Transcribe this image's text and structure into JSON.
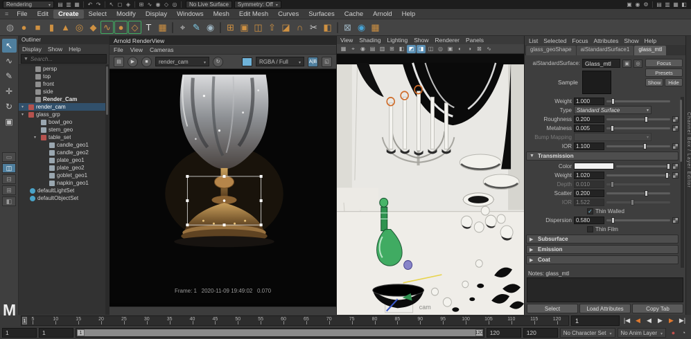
{
  "branding": {
    "logo_letter": "M"
  },
  "status_line": {
    "menuset": "Rendering",
    "live_surface": "No Live Surface",
    "symmetry": "Symmetry: Off",
    "left_icons": [
      {
        "name": "new-scene-icon",
        "glyph": "▤"
      },
      {
        "name": "open-scene-icon",
        "glyph": "▥"
      },
      {
        "name": "save-scene-icon",
        "glyph": "▦"
      },
      {
        "sep": true,
        "glyph": ""
      },
      {
        "name": "undo-icon",
        "glyph": "↶"
      },
      {
        "name": "redo-icon",
        "glyph": "↷"
      },
      {
        "sep": true,
        "glyph": ""
      },
      {
        "name": "select-by-hierarchy-icon",
        "glyph": "↖"
      },
      {
        "name": "select-by-object-icon",
        "glyph": "◻"
      },
      {
        "name": "select-by-component-icon",
        "glyph": "◈"
      },
      {
        "sep": true,
        "glyph": ""
      },
      {
        "name": "snap-to-grid-icon",
        "glyph": "⊞"
      },
      {
        "name": "snap-to-curve-icon",
        "glyph": "∿"
      },
      {
        "name": "snap-to-point-icon",
        "glyph": "◉"
      },
      {
        "name": "snap-to-plane-icon",
        "glyph": "◇"
      },
      {
        "name": "make-live-icon",
        "glyph": "◎"
      },
      {
        "sep": true,
        "glyph": ""
      }
    ],
    "right_icons": [
      {
        "name": "render-current-frame-icon",
        "glyph": "▣"
      },
      {
        "name": "ipr-render-icon",
        "glyph": "◉"
      },
      {
        "name": "render-settings-icon",
        "glyph": "⚙"
      },
      {
        "sep": true,
        "glyph": ""
      },
      {
        "name": "outliner-toggle-icon",
        "glyph": "▤"
      },
      {
        "name": "channel-box-toggle-icon",
        "glyph": "▥"
      },
      {
        "name": "attribute-editor-toggle-icon",
        "glyph": "▦",
        "active": true
      },
      {
        "name": "tool-settings-toggle-icon",
        "glyph": "◧"
      }
    ]
  },
  "menu_bar": {
    "grip": "≡",
    "items": [
      {
        "label": "File"
      },
      {
        "label": "Edit"
      },
      {
        "label": "Create",
        "active": true
      },
      {
        "label": "Select"
      },
      {
        "label": "Modify"
      },
      {
        "label": "Display"
      },
      {
        "label": "Windows"
      },
      {
        "label": "Mesh"
      },
      {
        "label": "Edit Mesh"
      },
      {
        "label": "Curves"
      },
      {
        "label": "Surfaces"
      },
      {
        "label": "Cache"
      },
      {
        "label": "Arnold"
      },
      {
        "label": "Help"
      }
    ]
  },
  "shelf": {
    "icons": [
      {
        "name": "shelf-tab-icon",
        "glyph": "◍",
        "color": "#9a9a9a"
      },
      {
        "name": "poly-sphere-icon",
        "glyph": "●",
        "color": "#cf9142"
      },
      {
        "name": "poly-cube-icon",
        "glyph": "■",
        "color": "#cf9142"
      },
      {
        "name": "poly-cylinder-icon",
        "glyph": "▮",
        "color": "#cf9142"
      },
      {
        "name": "poly-cone-icon",
        "glyph": "▲",
        "color": "#cf9142"
      },
      {
        "name": "poly-torus-icon",
        "glyph": "◎",
        "color": "#cf9142"
      },
      {
        "name": "poly-plane-icon",
        "glyph": "◆",
        "color": "#cf9142"
      },
      {
        "name": "curve-tool-icon",
        "glyph": "∿",
        "color": "#cf9142",
        "bracket": true
      },
      {
        "name": "circle-curve-icon",
        "glyph": "●",
        "color": "#cf9142",
        "bracket": true
      },
      {
        "name": "square-curve-icon",
        "glyph": "◇",
        "color": "#cf9142",
        "bracket": true
      },
      {
        "name": "type-tool-icon",
        "glyph": "T",
        "color": "#e6e6e6"
      },
      {
        "name": "construction-plane-icon",
        "glyph": "▦",
        "color": "#cf9142"
      },
      {
        "divider": true,
        "glyph": ""
      },
      {
        "name": "measure-tool-icon",
        "glyph": "⌖",
        "color": "#c9c9c9"
      },
      {
        "name": "paint-effects-icon",
        "glyph": "✎",
        "color": "#7ec8e3"
      },
      {
        "name": "sculpt-tool-icon",
        "glyph": "◉",
        "color": "#9fb6c3"
      },
      {
        "divider": true,
        "glyph": ""
      },
      {
        "name": "booleans-icon",
        "glyph": "⊞",
        "color": "#cf9142"
      },
      {
        "name": "combine-icon",
        "glyph": "▣",
        "color": "#cf9142"
      },
      {
        "name": "separate-icon",
        "glyph": "◫",
        "color": "#cf9142"
      },
      {
        "name": "extrude-icon",
        "glyph": "⇧",
        "color": "#cf9142"
      },
      {
        "name": "bevel-icon",
        "glyph": "◪",
        "color": "#cf9142"
      },
      {
        "name": "bridge-icon",
        "glyph": "∩",
        "color": "#cf9142"
      },
      {
        "name": "multi-cut-icon",
        "glyph": "✂",
        "color": "#d0d0d0"
      },
      {
        "name": "mirror-icon",
        "glyph": "◧",
        "color": "#cf9142"
      },
      {
        "divider": true,
        "glyph": ""
      },
      {
        "name": "uv-editor-icon",
        "glyph": "⊠",
        "color": "#9fb6c3"
      },
      {
        "name": "hypershade-icon",
        "glyph": "◉",
        "color": "#46a3d6"
      },
      {
        "name": "render-view-icon",
        "glyph": "▦",
        "color": "#cf9142"
      }
    ]
  },
  "toolbox": {
    "tools": [
      {
        "name": "select-tool",
        "glyph": "↖",
        "active": true
      },
      {
        "name": "lasso-tool",
        "glyph": "∿"
      },
      {
        "name": "paint-select-tool",
        "glyph": "✎"
      },
      {
        "name": "move-tool",
        "glyph": "✛"
      },
      {
        "name": "rotate-tool",
        "glyph": "↻"
      },
      {
        "name": "scale-tool",
        "glyph": "▣"
      }
    ],
    "layouts": [
      {
        "name": "layout-single-pane",
        "glyph": "▭"
      },
      {
        "name": "layout-two-pane",
        "glyph": "◫",
        "active": true
      },
      {
        "name": "layout-two-stacked",
        "glyph": "⊟"
      },
      {
        "name": "layout-four-pane",
        "glyph": "⊞"
      },
      {
        "name": "layout-outliner-persp",
        "glyph": "◧"
      }
    ]
  },
  "outliner": {
    "title": "Outliner",
    "menus": [
      "Display",
      "Show",
      "Help"
    ],
    "search_placeholder": "Search...",
    "filter_glyph": "▼",
    "items": [
      {
        "label": "persp",
        "icolor": "#8f8f8f",
        "pad": "14px"
      },
      {
        "label": "top",
        "icolor": "#8f8f8f",
        "pad": "14px"
      },
      {
        "label": "front",
        "icolor": "#8f8f8f",
        "pad": "14px"
      },
      {
        "label": "side",
        "icolor": "#8f8f8f",
        "pad": "14px"
      },
      {
        "label": "Render_Cam",
        "icolor": "#8f8f8f",
        "pad": "14px",
        "bold": true
      },
      {
        "label": "render_cam",
        "icolor": "#b5524e",
        "pad": "4px",
        "exp": true,
        "sel": true
      },
      {
        "label": "glass_grp",
        "icolor": "#b5524e",
        "pad": "4px",
        "exp": true
      },
      {
        "label": "bowl_geo",
        "icolor": "#9aa7b0",
        "pad": "22px"
      },
      {
        "label": "stem_geo",
        "icolor": "#9aa7b0",
        "pad": "22px"
      },
      {
        "label": "table_set",
        "icolor": "#b5524e",
        "pad": "22px",
        "exp": true
      },
      {
        "label": "candle_geo1",
        "icolor": "#9aa7b0",
        "pad": "34px"
      },
      {
        "label": "candle_geo2",
        "icolor": "#9aa7b0",
        "pad": "34px"
      },
      {
        "label": "plate_geo1",
        "icolor": "#9aa7b0",
        "pad": "34px"
      },
      {
        "label": "plate_geo2",
        "icolor": "#9aa7b0",
        "pad": "34px"
      },
      {
        "label": "goblet_geo1",
        "icolor": "#9aa7b0",
        "pad": "34px"
      },
      {
        "label": "napkin_geo1",
        "icolor": "#9aa7b0",
        "pad": "34px"
      },
      {
        "label": "defaultLightSet",
        "icolor": "#4aa3c8",
        "pad": "6px",
        "rnd": true
      },
      {
        "label": "defaultObjectSet",
        "icolor": "#4aa3c8",
        "pad": "6px",
        "rnd": true
      }
    ]
  },
  "render_view": {
    "title": "Arnold RenderView",
    "menus": [
      "File",
      "View",
      "Cameras"
    ],
    "toolbar": {
      "snapshot_glyph": "▤",
      "play_glyph": "▶",
      "stop_glyph": "■",
      "camera_value": "render_cam",
      "refresh_glyph": "↻",
      "display_value": "RGBA / Full",
      "ab_label": "A|B",
      "expand_glyph": "◱"
    },
    "frame_text": "Frame: 1   2020-11-09 19:49:02   0.070"
  },
  "viewport": {
    "menus": [
      "View",
      "Shading",
      "Lighting",
      "Show",
      "Renderer",
      "Panels"
    ],
    "camera_label": "cam",
    "icons": [
      {
        "name": "select-camera-icon",
        "glyph": "▦"
      },
      {
        "name": "lock-camera-icon",
        "glyph": "⌖"
      },
      {
        "name": "camera-attributes-icon",
        "glyph": "◉"
      },
      {
        "name": "bookmarks-icon",
        "glyph": "▤"
      },
      {
        "name": "image-plane-icon",
        "glyph": "▥"
      },
      {
        "name": "2d-pan-zoom-icon",
        "glyph": "⊞"
      },
      {
        "name": "oneclick-sync-icon",
        "glyph": "◧"
      },
      {
        "name": "isolate-select-icon",
        "glyph": "◩",
        "active": true
      },
      {
        "name": "xray-icon",
        "glyph": "◨",
        "active": true
      },
      {
        "name": "wireframe-on-shaded-icon",
        "glyph": "◫"
      },
      {
        "name": "default-material-icon",
        "glyph": "◎"
      },
      {
        "name": "textured-icon",
        "glyph": "▣"
      },
      {
        "name": "lighting-icon",
        "glyph": "◐"
      },
      {
        "name": "shadows-icon",
        "glyph": "◑"
      },
      {
        "name": "screen-space-ao-icon",
        "glyph": "⊠"
      },
      {
        "name": "motion-blur-icon",
        "glyph": "∿"
      }
    ]
  },
  "attribute_editor": {
    "menus": [
      "List",
      "Selected",
      "Focus",
      "Attributes",
      "Show",
      "Help"
    ],
    "tabs": [
      {
        "label": "glass_geoShape"
      },
      {
        "label": "aiStandardSurface1"
      },
      {
        "label": "glass_mtl",
        "active": true
      }
    ],
    "name_label": "aiStandardSurface:",
    "name_value": "Glass_mtl",
    "buttons": {
      "focus": "Focus",
      "presets": "Presets",
      "show": "Show",
      "hide": "Hide"
    },
    "sample_label": "Sample",
    "rows": [
      {
        "label": "Weight",
        "value": "1.000",
        "fill": "8%",
        "nock": true
      },
      {
        "label": "Type",
        "value": "Standard Surface",
        "dd": true
      },
      {
        "label": "Roughness",
        "value": "0.200",
        "fill": "60%"
      },
      {
        "label": "Metalness",
        "value": "0.005",
        "fill": "6%"
      },
      {
        "label": "Bump Mapping",
        "value": "",
        "dd": true,
        "dim": true
      },
      {
        "label": "IOR",
        "value": "1.100",
        "fill": "58%"
      },
      {
        "label": "Transmission",
        "sec": true,
        "open": true
      },
      {
        "label": "Color",
        "swatch": "#f2f2f2",
        "fill": "93%",
        "col": true
      },
      {
        "label": "Weight",
        "value": "1.020",
        "fill": "92%"
      },
      {
        "label": "Depth",
        "value": "0.010",
        "fill": "6%",
        "dim": true,
        "nock": true
      },
      {
        "label": "Scatter",
        "value": "0.200",
        "fill": "60%",
        "nock": true
      },
      {
        "label": "IOR",
        "value": "1.522",
        "fill": "38%",
        "dim": true,
        "nock": true
      },
      {
        "label": "Thin Walled",
        "chk": true,
        "on": true
      },
      {
        "label": "Dispersion",
        "value": "0.580",
        "fill": "8%"
      },
      {
        "label": "Thin Film",
        "chk": true
      },
      {
        "label": "Subsurface",
        "sec": true
      },
      {
        "label": "Emission",
        "sec": true
      },
      {
        "label": "Coat",
        "sec": true
      }
    ],
    "notes_label": "Notes: glass_mtl",
    "footer_buttons": [
      "Select",
      "Load Attributes",
      "Copy Tab"
    ]
  },
  "right_strip": {
    "label": "Channel Box / Layer Editor"
  },
  "timeline": {
    "cursor_label": "1",
    "ticks": [
      "5",
      "10",
      "15",
      "20",
      "25",
      "30",
      "35",
      "40",
      "45",
      "50",
      "55",
      "60",
      "65",
      "70",
      "75",
      "80",
      "85",
      "90",
      "95",
      "100",
      "105",
      "110",
      "115",
      "120"
    ],
    "current_frame": "1",
    "playback_buttons": [
      {
        "name": "go-to-start-button",
        "glyph": "|◀",
        "c": "#d8d8d8"
      },
      {
        "name": "step-back-key-button",
        "glyph": "◀",
        "c": "#e0792f"
      },
      {
        "name": "play-backwards-button",
        "glyph": "◀",
        "c": "#d8d8d8"
      },
      {
        "name": "play-forward-button",
        "glyph": "▶",
        "c": "#d8d8d8"
      },
      {
        "name": "step-forward-key-button",
        "glyph": "▶",
        "c": "#e0792f"
      },
      {
        "name": "go-to-end-button",
        "glyph": "▶|",
        "c": "#d8d8d8"
      }
    ],
    "range": {
      "start_field": "1",
      "playback_start_field": "1",
      "handle_start": "1",
      "handle_end": "120",
      "playback_end_field": "120",
      "end_field": "120"
    },
    "character_set": "No Character Set",
    "anim_layer": "No Anim Layer",
    "right_icons": [
      {
        "name": "auto-keyframe-icon",
        "glyph": "●",
        "c": "#c0504d"
      },
      {
        "name": "animation-preferences-icon",
        "glyph": "◔",
        "c": "#bbbbbb"
      }
    ]
  }
}
